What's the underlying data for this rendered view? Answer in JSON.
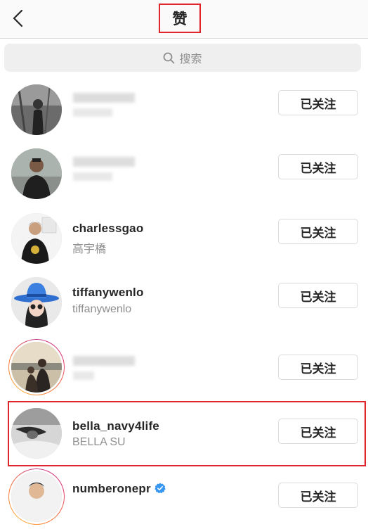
{
  "header": {
    "title": "赞",
    "back_icon": "chevron-left-icon"
  },
  "search": {
    "placeholder": "搜索",
    "icon": "search-icon"
  },
  "users": [
    {
      "username": "",
      "fullname": "",
      "blurred": true,
      "button": "已关注"
    },
    {
      "username": "",
      "fullname": "",
      "blurred": true,
      "button": "已关注"
    },
    {
      "username": "charlessgao",
      "fullname": "高宇橋",
      "blurred": false,
      "button": "已关注"
    },
    {
      "username": "tiffanywenlo",
      "fullname": "tiffanywenlo",
      "blurred": false,
      "button": "已关注"
    },
    {
      "username": "",
      "fullname": "",
      "blurred": true,
      "story_ring": true,
      "button": "已关注"
    },
    {
      "username": "bella_navy4life",
      "fullname": "BELLA SU",
      "blurred": false,
      "highlighted": true,
      "button": "已关注"
    },
    {
      "username": "numberonepr",
      "fullname": "",
      "blurred": false,
      "story_ring": true,
      "verified": true,
      "button": "已关注"
    }
  ],
  "colors": {
    "highlight": "#e0262b",
    "verified": "#3897f0",
    "secondary_text": "#8e8e8e"
  }
}
